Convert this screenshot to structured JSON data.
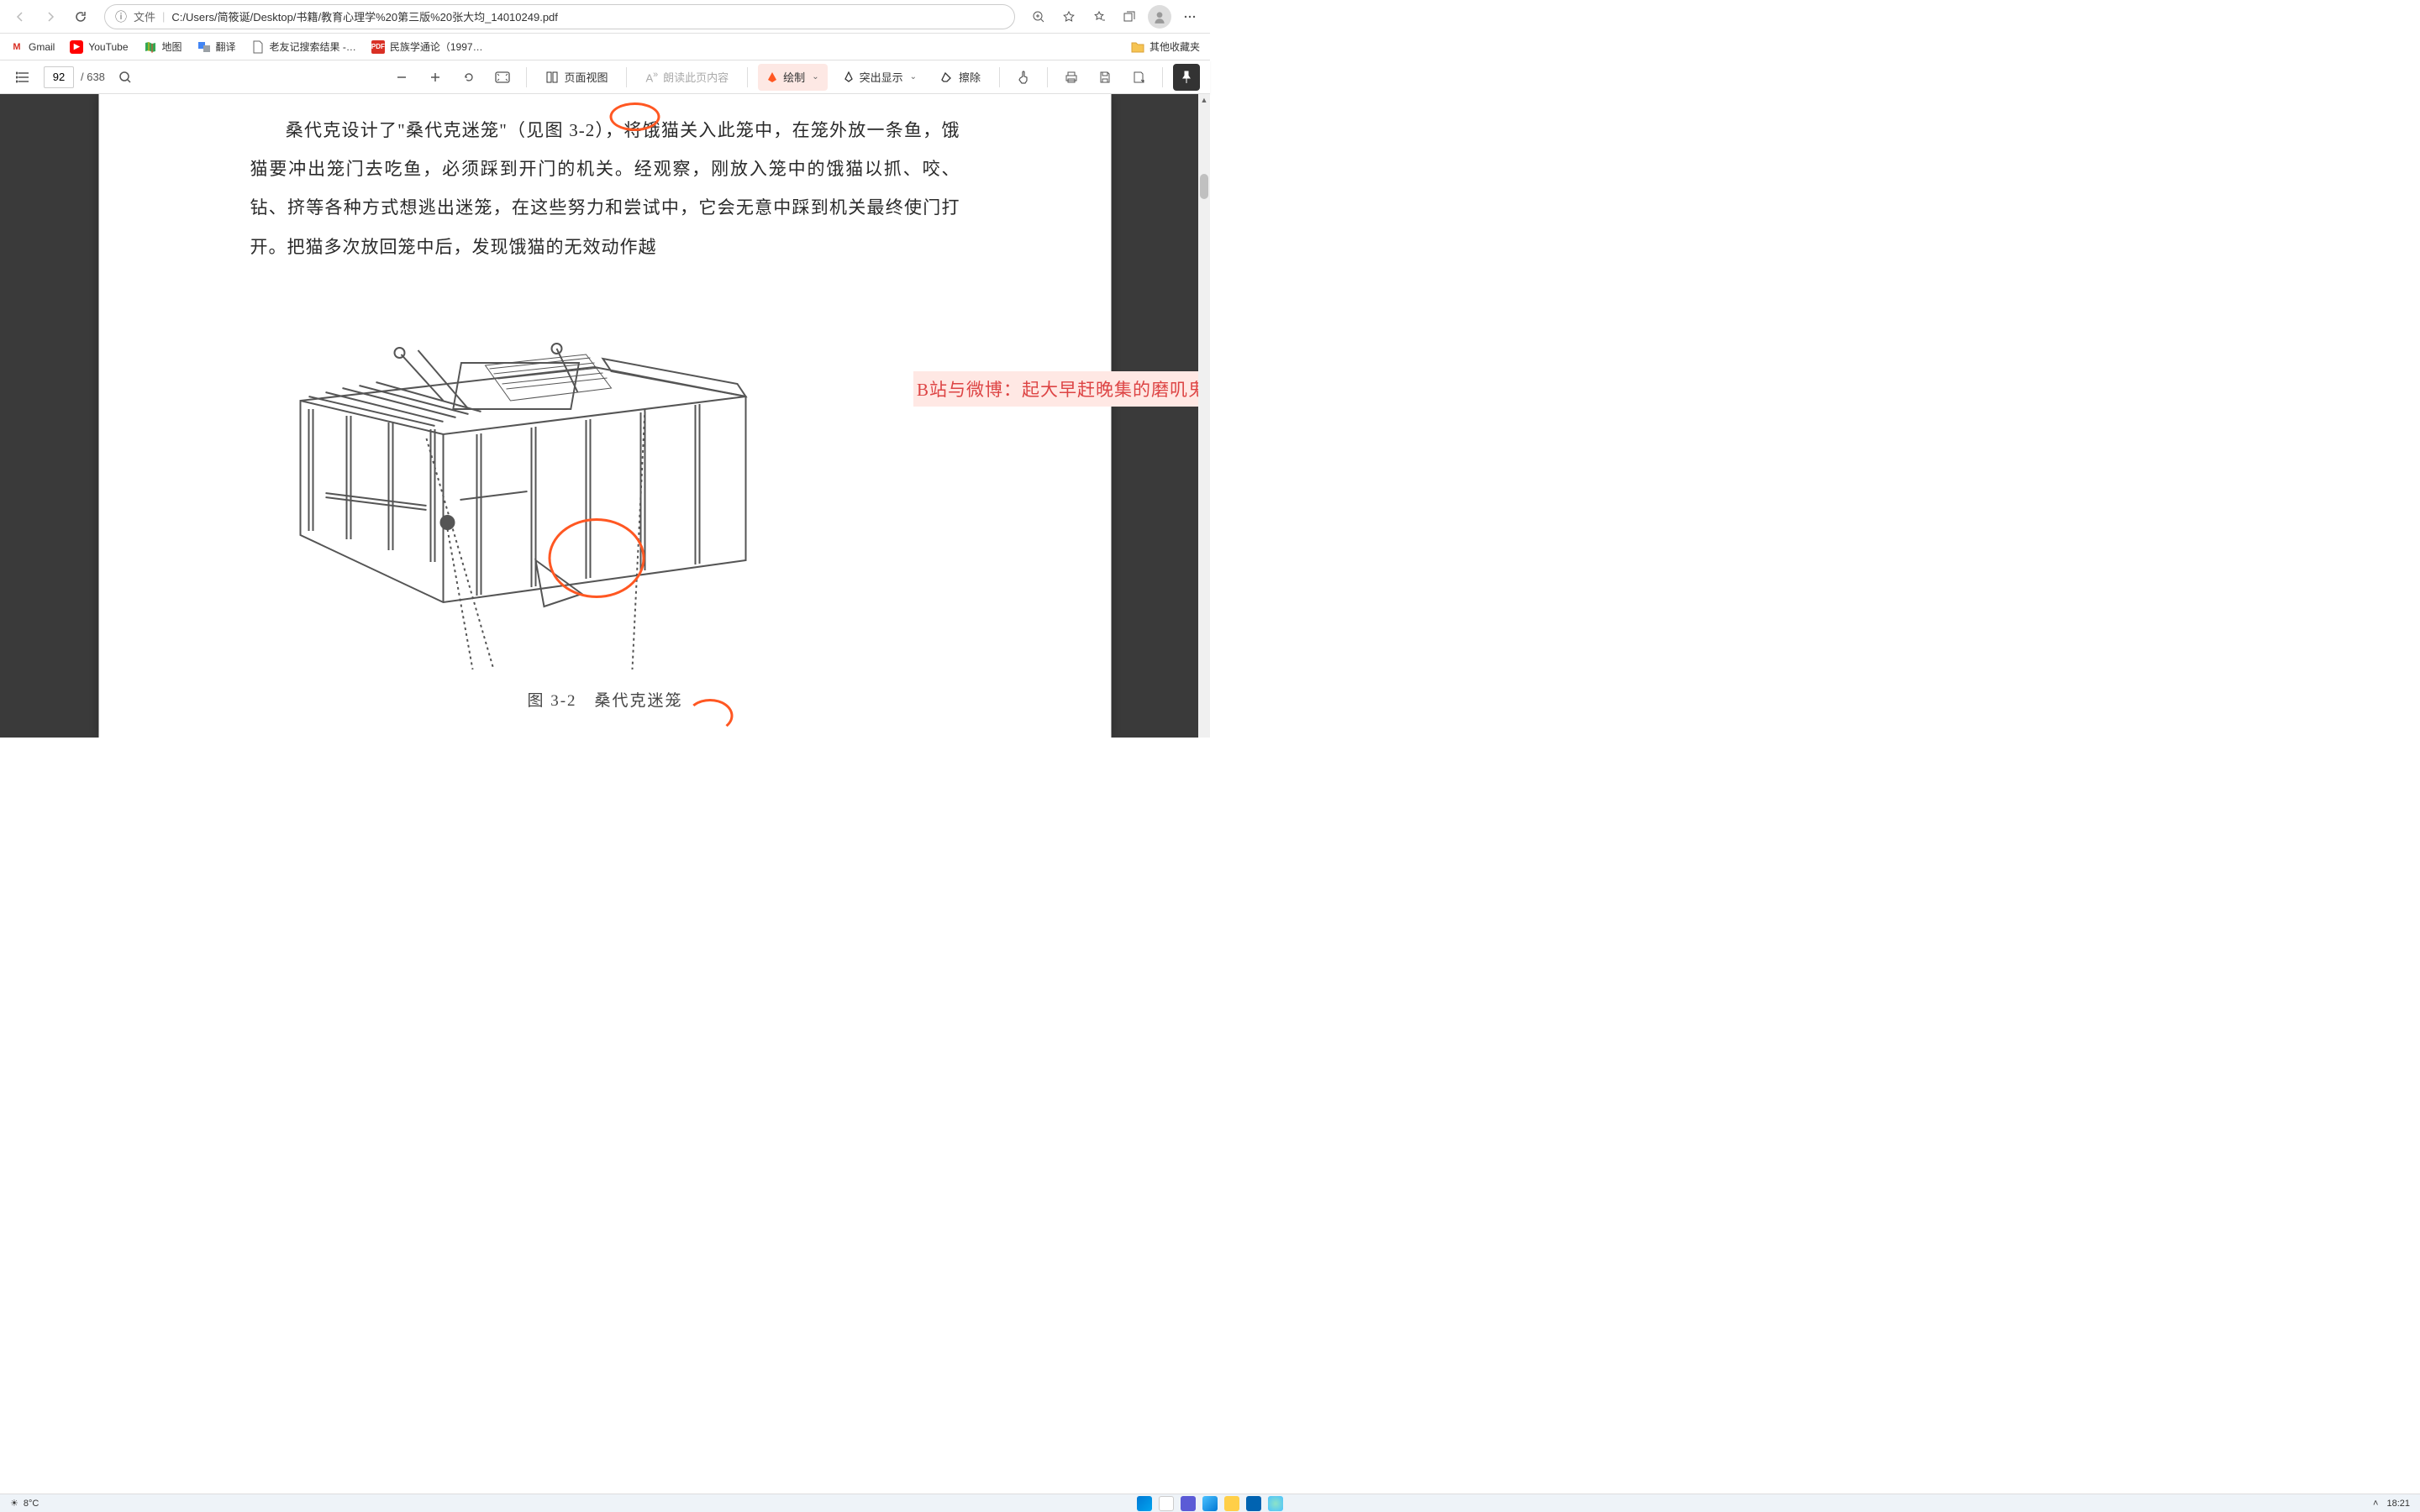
{
  "browser": {
    "url_label": "文件",
    "url_path": "C:/Users/简筱诞/Desktop/书籍/教育心理学%20第三版%20张大均_14010249.pdf"
  },
  "bookmarks": {
    "gmail": "Gmail",
    "youtube": "YouTube",
    "maps": "地图",
    "translate": "翻译",
    "search_result": "老友记搜索结果 -…",
    "ethnology": "民族学通论（1997…",
    "other": "其他收藏夹"
  },
  "pdfbar": {
    "current_page": "92",
    "total_pages": "/ 638",
    "page_view": "页面视图",
    "read_aloud": "朗读此页内容",
    "draw": "绘制",
    "highlight": "突出显示",
    "erase": "擦除"
  },
  "document": {
    "paragraph": "桑代克设计了\"桑代克迷笼\"（见图 3-2），将饿猫关入此笼中，在笼外放一条鱼，饿猫要冲出笼门去吃鱼，必须踩到开门的机关。经观察，刚放入笼中的饿猫以抓、咬、钻、挤等各种方式想逃出迷笼，在这些努力和尝试中，它会无意中踩到机关最终使门打开。把猫多次放回笼中后，发现饿猫的无效动作越",
    "figure_caption": "图 3-2　桑代克迷笼"
  },
  "watermark": "B站与微博：起大早赶晚集的磨叽鬼",
  "taskbar": {
    "temperature": "8°C",
    "time": "18:21"
  }
}
